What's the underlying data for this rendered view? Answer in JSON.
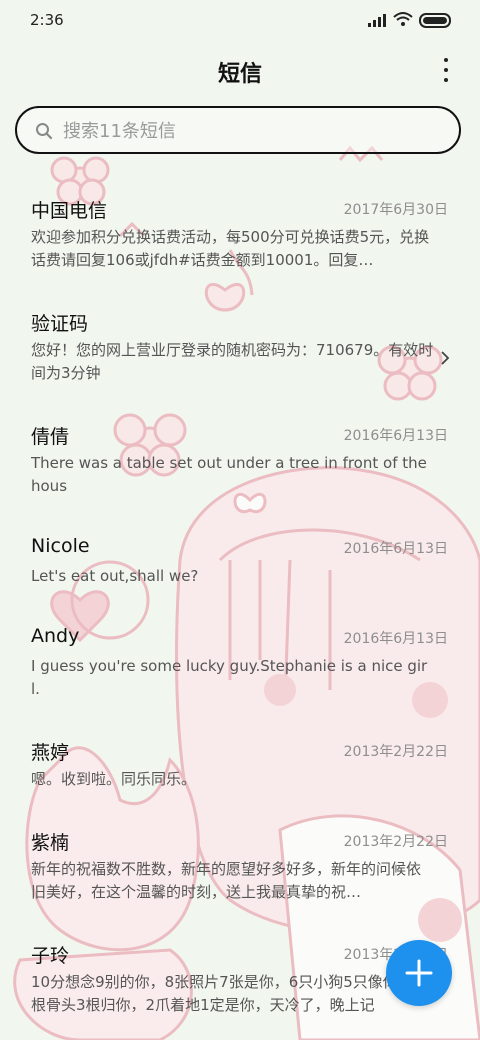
{
  "status_bar": {
    "time": "2:36"
  },
  "header": {
    "title": "短信"
  },
  "search": {
    "placeholder": "搜索11条短信"
  },
  "colors": {
    "accent": "#1e90ee",
    "background": "#f1f6ee",
    "wallpaper_pink": "#f3c9cf"
  },
  "messages": [
    {
      "name": "中国电信",
      "date": "2017年6月30日",
      "preview": "欢迎参加积分兑换话费活动，每500分可兑换话费5元，兑换话费请回复106或jfdh#话费金额到10001。回复…"
    },
    {
      "name": "验证码",
      "date": "",
      "preview": "您好！您的网上营业厅登录的随机密码为：710679。有效时间为3分钟"
    },
    {
      "name": "倩倩",
      "date": "2016年6月13日",
      "preview": "There was a table set out under a tree in front of the hous"
    },
    {
      "name": "Nicole",
      "date": "2016年6月13日",
      "preview": "Let's eat out,shall we?"
    },
    {
      "name": "Andy",
      "date": "2016年6月13日",
      "preview": "I guess you're some lucky guy.Stephanie is a nice girl."
    },
    {
      "name": "燕婷",
      "date": "2013年2月22日",
      "preview": "嗯。收到啦。同乐同乐。"
    },
    {
      "name": "紫楠",
      "date": "2013年2月22日",
      "preview": "新年的祝福数不胜数，新年的愿望好多好多，新年的问候依旧美好，在这个温馨的时刻，送上我最真挚的祝…"
    },
    {
      "name": "子玲",
      "date": "2013年2月22日",
      "preview": "10分想念9别的你，8张照片7张是你，6只小狗5只像你，4根骨头3根归你，2爪着地1定是你，天冷了，晚上记"
    }
  ]
}
